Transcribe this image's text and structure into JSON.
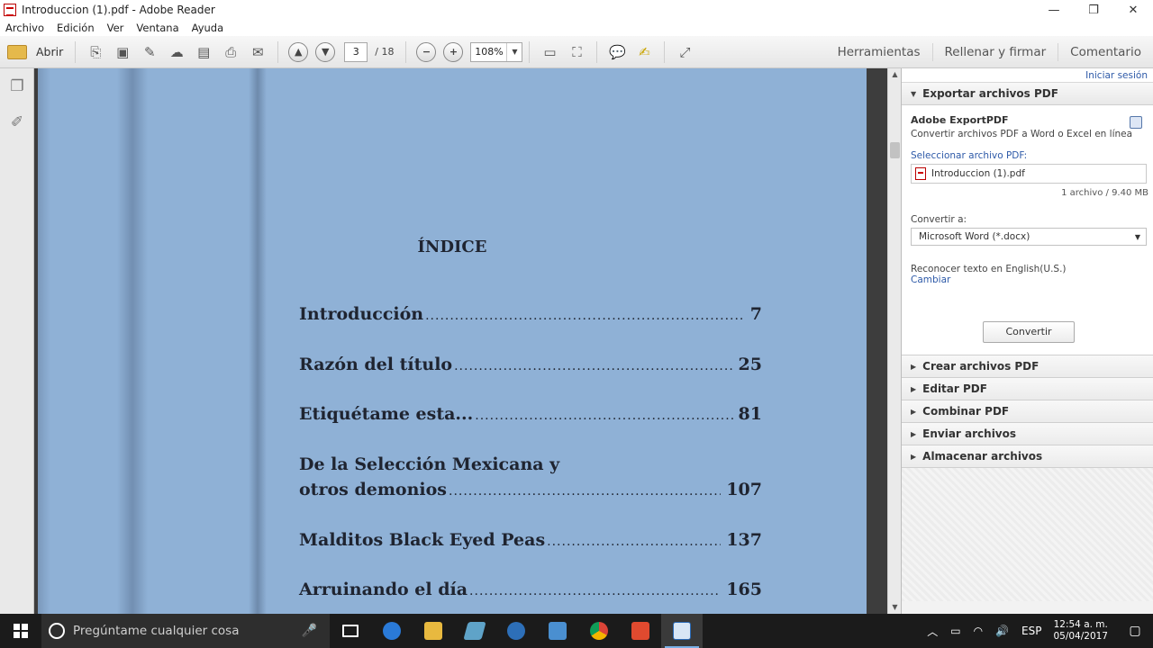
{
  "window": {
    "title": "Introduccion (1).pdf - Adobe Reader",
    "minimize": "—",
    "maximize": "❐",
    "close": "✕"
  },
  "menu": [
    "Archivo",
    "Edición",
    "Ver",
    "Ventana",
    "Ayuda"
  ],
  "toolbar": {
    "open_label": "Abrir",
    "current_page": "3",
    "total_pages": "/ 18",
    "zoom": "108%",
    "right_tabs": [
      "Herramientas",
      "Rellenar y firmar",
      "Comentario"
    ]
  },
  "document": {
    "index_title": "ÍNDICE",
    "toc": [
      {
        "lines": [
          "Introducción"
        ],
        "page": "7"
      },
      {
        "lines": [
          "Razón del título"
        ],
        "page": "25"
      },
      {
        "lines": [
          "Etiquétame esta..."
        ],
        "page": "81"
      },
      {
        "lines": [
          "De la Selección Mexicana y",
          "otros demonios"
        ],
        "page": "107"
      },
      {
        "lines": [
          "Malditos Black Eyed Peas"
        ],
        "page": "137"
      },
      {
        "lines": [
          "Arruinando el día"
        ],
        "page": "165"
      }
    ]
  },
  "right_pane": {
    "signin": "Iniciar sesión",
    "export_header": "Exportar archivos PDF",
    "export": {
      "title": "Adobe ExportPDF",
      "subtitle": "Convertir archivos PDF a Word o Excel en línea",
      "select_label": "Seleccionar archivo PDF:",
      "file_name": "Introduccion (1).pdf",
      "file_meta": "1 archivo / 9.40 MB",
      "convert_to_label": "Convertir a:",
      "convert_to_value": "Microsoft Word (*.docx)",
      "ocr_label": "Reconocer texto en English(U.S.)",
      "ocr_link": "Cambiar",
      "convert_button": "Convertir"
    },
    "sections": [
      "Crear archivos PDF",
      "Editar PDF",
      "Combinar PDF",
      "Enviar archivos",
      "Almacenar archivos"
    ]
  },
  "taskbar": {
    "search_placeholder": "Pregúntame cualquier cosa",
    "language": "ESP",
    "time": "12:54 a. m.",
    "date": "05/04/2017"
  }
}
